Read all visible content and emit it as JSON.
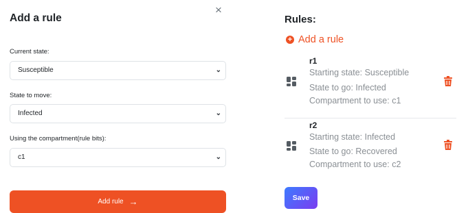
{
  "modal": {
    "title": "Add a rule",
    "close_label": "×",
    "current_state_label": "Current state:",
    "current_state_value": "Susceptible",
    "state_to_move_label": "State to move:",
    "state_to_move_value": "Infected",
    "compartment_label": "Using the compartment(rule bits):",
    "compartment_value": "c1",
    "add_button_label": "Add rule",
    "add_button_arrow": "→"
  },
  "rules_panel": {
    "title": "Rules:",
    "add_link_label": "Add a rule",
    "rules": [
      {
        "name": "r1",
        "starting_state": "Starting state: Susceptible",
        "state_to_go": "State to go: Infected",
        "compartment": "Compartment to use: c1"
      },
      {
        "name": "r2",
        "starting_state": "Starting state: Infected",
        "state_to_go": "State to go: Recovered",
        "compartment": "Compartment to use: c2"
      }
    ],
    "save_label": "Save"
  },
  "colors": {
    "accent": "#ee5124",
    "save_gradient_start": "#3d7bff",
    "save_gradient_end": "#7a3cf0"
  },
  "icons": {
    "close": "close-icon",
    "chevron": "chevron-down-icon",
    "plus": "plus-circle-icon",
    "drag": "drag-grid-icon",
    "delete": "trash-icon",
    "arrow": "arrow-right-icon"
  }
}
